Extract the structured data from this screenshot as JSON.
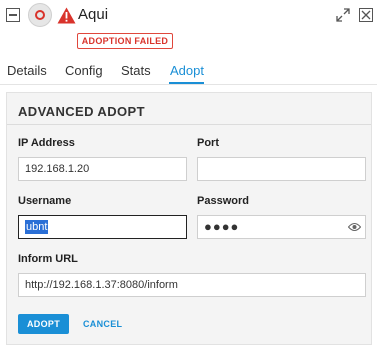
{
  "header": {
    "device_name": "Aqui",
    "status_badge": "ADOPTION FAILED"
  },
  "tabs": [
    {
      "label": "Details",
      "active": false
    },
    {
      "label": "Config",
      "active": false
    },
    {
      "label": "Stats",
      "active": false
    },
    {
      "label": "Adopt",
      "active": true
    }
  ],
  "adopt": {
    "title": "ADVANCED ADOPT",
    "ip_label": "IP Address",
    "ip_value": "192.168.1.20",
    "port_label": "Port",
    "port_value": "",
    "username_label": "Username",
    "username_value": "ubnt",
    "password_label": "Password",
    "password_masked": "●●●●",
    "inform_label": "Inform URL",
    "inform_value": "http://192.168.1.37:8080/inform",
    "adopt_button": "ADOPT",
    "cancel_button": "CANCEL"
  },
  "colors": {
    "accent": "#1a8fd6",
    "error": "#d9332b"
  },
  "icons": [
    "collapse-icon",
    "device-icon",
    "warning-icon",
    "expand-icon",
    "close-icon",
    "eye-icon"
  ]
}
